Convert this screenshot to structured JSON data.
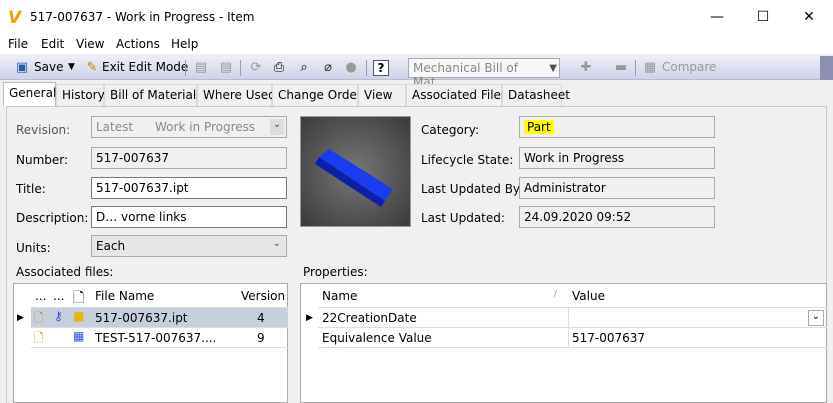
{
  "window": {
    "title": "517-007637 - Work in Progress - Item",
    "minimize": "—",
    "maximize": "☐",
    "close": "✕"
  },
  "menu": [
    "File",
    "Edit",
    "View",
    "Actions",
    "Help"
  ],
  "toolbar": {
    "save": "Save",
    "exit_edit": "Exit Edit Mode",
    "bom_view": "Mechanical Bill of Mat...",
    "compare": "Compare",
    "help": "?"
  },
  "tabs": [
    "General",
    "History",
    "Bill of Materials",
    "Where Used",
    "Change Order",
    "View",
    "Associated Files",
    "Datasheet"
  ],
  "form": {
    "revision_label": "Revision:",
    "revision_value": "Latest",
    "revision_state": "Work in Progress",
    "number_label": "Number:",
    "number_value": "517-007637",
    "title_label": "Title:",
    "title_value": "517-007637.ipt",
    "description_label": "Description:",
    "description_value": "D… vorne links",
    "units_label": "Units:",
    "units_value": "Each",
    "category_label": "Category:",
    "category_value": "Part",
    "lifecycle_label": "Lifecycle State:",
    "lifecycle_value": "Work in Progress",
    "updated_by_label": "Last Updated By:",
    "updated_by_value": "Administrator",
    "updated_label": "Last Updated:",
    "updated_value": "24.09.2020 09:52"
  },
  "files": {
    "label": "Associated files:",
    "headers": [
      "...",
      "...",
      "File Name",
      "Version"
    ],
    "rows": [
      {
        "name": "517-007637.ipt",
        "version": "4"
      },
      {
        "name": "TEST-517-007637....",
        "version": "9"
      }
    ]
  },
  "properties": {
    "label": "Properties:",
    "headers": [
      "Name",
      "Value"
    ],
    "rows": [
      {
        "name": "22CreationDate",
        "value": ""
      },
      {
        "name": "Equivalence Value",
        "value": "517-007637"
      }
    ]
  },
  "colors": {
    "highlight": "#ffff00",
    "selected_row": "#c5d0dc",
    "accent": "#2a54d8"
  }
}
